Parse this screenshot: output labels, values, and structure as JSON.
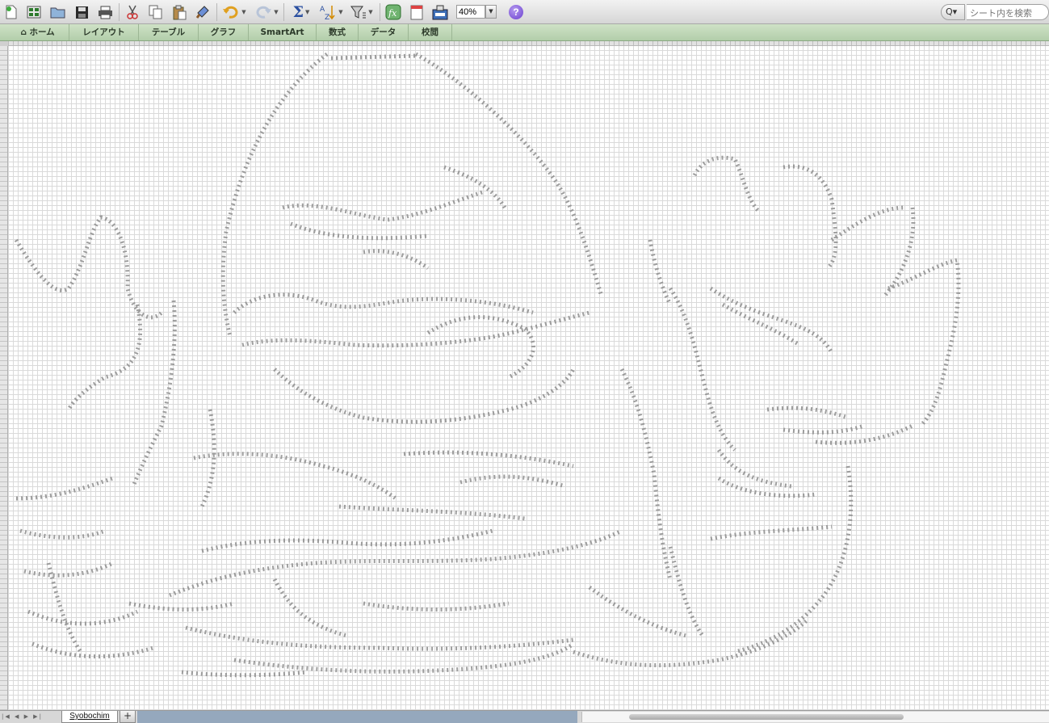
{
  "toolbar": {
    "zoom_value": "40%",
    "search_placeholder": "シート内を検索",
    "help_label": "?",
    "search_icon_label": "Q▾",
    "icons": [
      "new-document-icon",
      "gallery-icon",
      "open-icon",
      "save-icon",
      "print-icon",
      "cut-icon",
      "copy-icon",
      "paste-icon",
      "format-painter-icon",
      "undo-icon",
      "redo-icon",
      "autosum-icon",
      "sort-icon",
      "filter-icon",
      "function-icon",
      "show-formulas-icon",
      "toolbox-icon",
      "help-icon"
    ]
  },
  "ribbon": {
    "tabs": [
      "ホーム",
      "レイアウト",
      "テーブル",
      "グラフ",
      "SmartArt",
      "数式",
      "データ",
      "校閲"
    ],
    "home_icon": "house-icon"
  },
  "sheet": {
    "tab_name": "Syobochim",
    "add_sheet_label": "+",
    "nav_arrows": "|◀ ◀ ▶ ▶|"
  },
  "colors": {
    "ribbon_green": "#b7d0ae",
    "toolbar_gray": "#dcdcdc",
    "tabbar_blue": "#95a8bd",
    "art_gray": "#8a8a8a"
  }
}
